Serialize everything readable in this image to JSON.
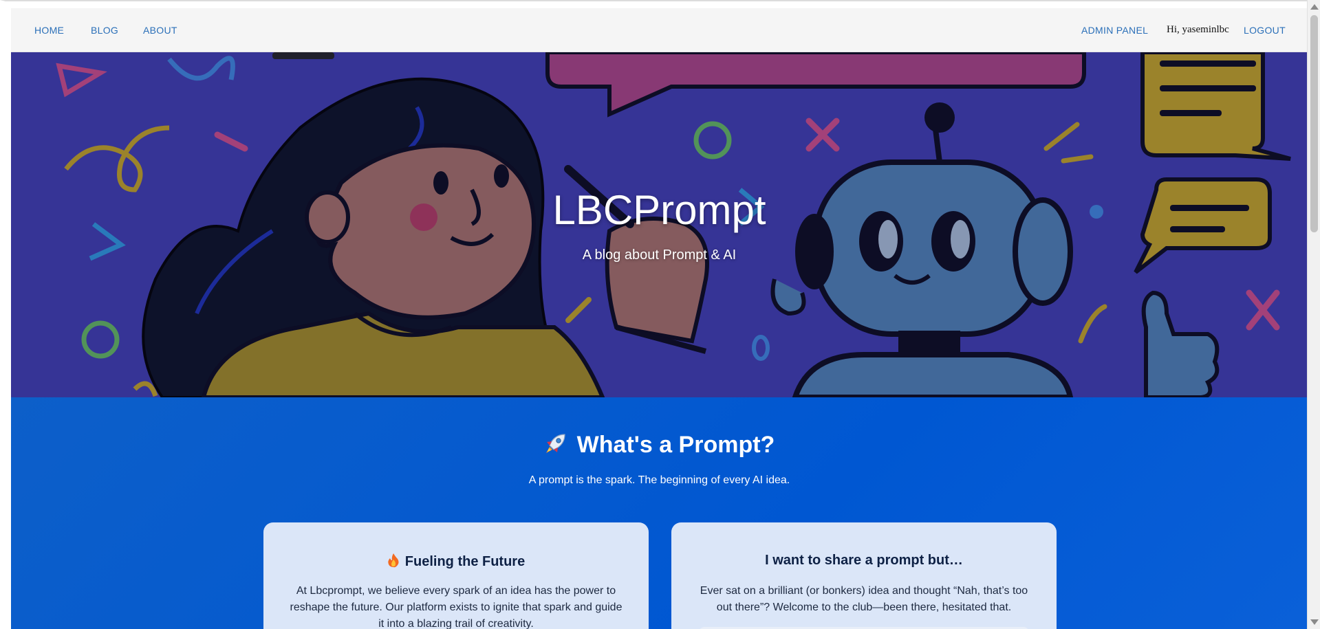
{
  "nav": {
    "home": "HOME",
    "blog": "BLOG",
    "about": "ABOUT",
    "admin_panel": "ADMIN PANEL",
    "greeting": "Hi, yaseminlbc",
    "logout": "LOGOUT"
  },
  "hero": {
    "title": "LBCPrompt",
    "subtitle": "A blog about Prompt & AI"
  },
  "section": {
    "title": "What's a Prompt?",
    "subtitle": "A prompt is the spark. The beginning of every AI idea.",
    "title_icon": "rocket-icon"
  },
  "cards": [
    {
      "title": "Fueling the Future",
      "icon": "flame-icon",
      "body": "At Lbcprompt, we believe every spark of an idea has the power to reshape the future. Our platform exists to ignite that spark and guide it into a blazing trail of creativity."
    },
    {
      "title": "I want to share a prompt but…",
      "body": "Ever sat on a brilliant (or bonkers) idea and thought “Nah, that’s too out there”? Welcome to the club—been there, hesitated that."
    }
  ],
  "colors": {
    "nav_link": "#2a6fb8",
    "hero_bg": "#3c3aa4",
    "section_bg": "#0057d2",
    "card_bg": "#dbe6f8"
  }
}
